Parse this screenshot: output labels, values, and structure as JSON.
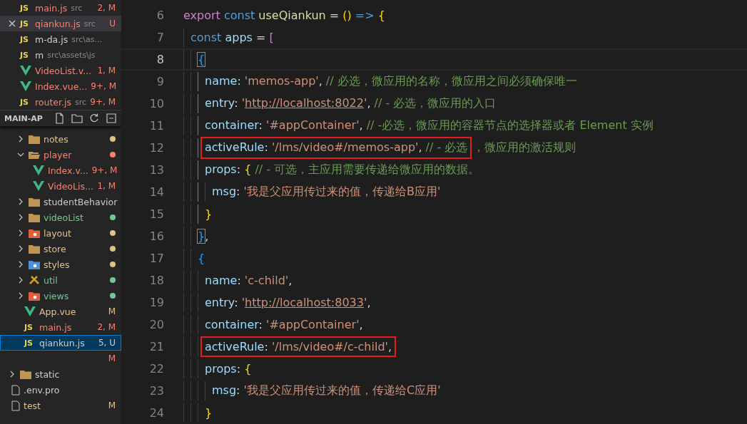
{
  "open_editors": [
    {
      "kind": "js",
      "icon": "JS",
      "name": "main.js",
      "desc": "src",
      "badge": "2, M",
      "color": "#f88070",
      "hovered": false
    },
    {
      "kind": "js",
      "icon": "JS",
      "name": "qiankun.js",
      "desc": "src",
      "badge": "U",
      "color": "#f88070",
      "hovered": true
    },
    {
      "kind": "js",
      "icon": "JS",
      "name": "m-da.js",
      "desc": "src\\as...",
      "color": "#cccccc",
      "hovered": false
    },
    {
      "kind": "js",
      "icon": "JS",
      "name": "m",
      "desc": "src\\assets\\js",
      "color": "#cccccc",
      "hovered": false
    },
    {
      "kind": "vue",
      "name": "VideoList.v...",
      "badge": "1, M",
      "color": "#f88070",
      "hovered": false
    },
    {
      "kind": "vue",
      "name": "Index.vue...",
      "badge": "9+, M",
      "color": "#f88070",
      "hovered": false
    },
    {
      "kind": "js",
      "icon": "JS",
      "name": "router.js",
      "desc": "src",
      "badge": "9+, M",
      "color": "#f88070",
      "hovered": false
    }
  ],
  "explorer": {
    "title": "MAIN-AP"
  },
  "tree": [
    {
      "kind": "group",
      "children": [
        {
          "kind": "folder",
          "name": "notes",
          "expanded": false,
          "color": "#e2c08d",
          "dot": true,
          "selected": false
        },
        {
          "kind": "folder",
          "name": "player",
          "expanded": true,
          "color": "#f88070",
          "dot": true,
          "selected": false,
          "children": [
            {
              "kind": "vue",
              "name": "Index.v...",
              "badge": "9+, M",
              "color": "#f88070",
              "selected": false
            },
            {
              "kind": "vue",
              "name": "VideoLis...",
              "badge": "1, M",
              "color": "#f88070",
              "selected": false
            }
          ]
        },
        {
          "kind": "folder",
          "name": "studentBehavior",
          "expanded": false,
          "color": "#cccccc",
          "dot": false,
          "selected": false
        },
        {
          "kind": "folder",
          "name": "videoList",
          "expanded": false,
          "color": "#73c991",
          "dot": true,
          "selected": false
        },
        {
          "kind": "folder_red",
          "name": "layout",
          "expanded": false,
          "color": "#e2c08d",
          "dot": true,
          "selected": false
        },
        {
          "kind": "folder",
          "name": "store",
          "expanded": false,
          "color": "#e2c08d",
          "dot": true,
          "selected": false
        },
        {
          "kind": "folder_blue",
          "name": "styles",
          "expanded": false,
          "color": "#e2c08d",
          "dot": true,
          "selected": false
        },
        {
          "kind": "folder_tools",
          "name": "util",
          "expanded": false,
          "color": "#73c991",
          "dot": true,
          "selected": false
        },
        {
          "kind": "folder_red",
          "name": "views",
          "expanded": false,
          "color": "#73c991",
          "dot": true,
          "selected": false
        },
        {
          "kind": "vue",
          "name": "App.vue",
          "badge": "M",
          "color": "#e2c08d",
          "selected": false
        },
        {
          "kind": "js",
          "icon": "JS",
          "name": "main.js",
          "badge": "2, M",
          "color": "#f88070",
          "selected": false
        },
        {
          "kind": "js",
          "icon": "JS",
          "name": "qiankun.js",
          "badge": "5, U",
          "color": "#cccccc",
          "selected": true
        },
        {
          "kind": "blank",
          "badge": "M",
          "color": "#f88070",
          "selected": false
        }
      ]
    },
    {
      "kind": "folder",
      "name": "static",
      "expanded": false,
      "color": "#cccccc",
      "dot": false,
      "selected": false
    },
    {
      "kind": "file",
      "name": ".env.pro",
      "color": "#cccccc",
      "selected": false
    },
    {
      "kind": "file",
      "name": "test",
      "badge": "M",
      "color": "#e2c08d",
      "selected": false
    }
  ],
  "editor": {
    "lines": [
      {
        "number": "6",
        "current": false,
        "tokens": [
          {
            "kind": "export",
            "text": "export"
          },
          {
            "kind": "keyword",
            "text": " const "
          },
          {
            "kind": "func",
            "text": "useQiankun"
          },
          {
            "kind": "punct",
            "text": " = "
          },
          {
            "kind": "bracket1",
            "text": "()"
          },
          {
            "kind": "keyword",
            "text": " => "
          },
          {
            "kind": "bracket1",
            "text": "{"
          }
        ]
      },
      {
        "number": "7",
        "current": false,
        "guides": [
          {
            "active": false
          }
        ],
        "tokens": [
          {
            "kind": "keyword",
            "text": "const "
          },
          {
            "kind": "var",
            "text": "apps"
          },
          {
            "kind": "punct",
            "text": " = "
          },
          {
            "kind": "bracket2",
            "text": "["
          }
        ]
      },
      {
        "number": "8",
        "current": true,
        "guides": [
          {
            "active": false
          },
          {
            "active": false
          }
        ],
        "tokens": [
          {
            "kind": "match",
            "text": "{"
          }
        ]
      },
      {
        "number": "9",
        "current": false,
        "guides": [
          {
            "active": false
          },
          {
            "active": false
          },
          {
            "active": true
          }
        ],
        "tokens": [
          {
            "kind": "prop",
            "text": "name"
          },
          {
            "kind": "punct",
            "text": ": "
          },
          {
            "kind": "string",
            "text": "'memos-app'"
          },
          {
            "kind": "punct",
            "text": ", "
          },
          {
            "kind": "comment",
            "text": "// 必选，微应用的名称，微应用之间必须确保唯一"
          }
        ]
      },
      {
        "number": "10",
        "current": false,
        "guides": [
          {
            "active": false
          },
          {
            "active": false
          },
          {
            "active": true
          }
        ],
        "tokens": [
          {
            "kind": "prop",
            "text": "entry"
          },
          {
            "kind": "punct",
            "text": ": "
          },
          {
            "kind": "string",
            "text": "'"
          },
          {
            "kind": "url",
            "text": "http://localhost:8022"
          },
          {
            "kind": "string",
            "text": "'"
          },
          {
            "kind": "punct",
            "text": ", "
          },
          {
            "kind": "comment",
            "text": "// - 必选，微应用的入口"
          }
        ]
      },
      {
        "number": "11",
        "current": false,
        "guides": [
          {
            "active": false
          },
          {
            "active": false
          },
          {
            "active": true
          }
        ],
        "tokens": [
          {
            "kind": "prop",
            "text": "container"
          },
          {
            "kind": "punct",
            "text": ": "
          },
          {
            "kind": "string",
            "text": "'#appContainer'"
          },
          {
            "kind": "punct",
            "text": ", "
          },
          {
            "kind": "comment",
            "text": "// -必选，微应用的容器节点的选择器或者 Element 实例"
          }
        ]
      },
      {
        "number": "12",
        "current": false,
        "guides": [
          {
            "active": false
          },
          {
            "active": false
          },
          {
            "active": true
          }
        ],
        "boxed_tokens": [
          {
            "kind": "prop",
            "text": "activeRule"
          },
          {
            "kind": "punct",
            "text": ": "
          },
          {
            "kind": "string",
            "text": "'/lms/video#/memos-app'"
          },
          {
            "kind": "punct",
            "text": ", "
          },
          {
            "kind": "comment",
            "text": "// - 必选"
          }
        ],
        "tokens": [
          {
            "kind": "comment",
            "text": "，微应用的激活规则"
          }
        ]
      },
      {
        "number": "13",
        "current": false,
        "guides": [
          {
            "active": false
          },
          {
            "active": false
          },
          {
            "active": true
          }
        ],
        "tokens": [
          {
            "kind": "prop",
            "text": "props"
          },
          {
            "kind": "punct",
            "text": ": "
          },
          {
            "kind": "bracket1",
            "text": "{"
          },
          {
            "kind": "comment",
            "text": " // - 可选，主应用需要传递给微应用的数据。"
          }
        ]
      },
      {
        "number": "14",
        "current": false,
        "guides": [
          {
            "active": false
          },
          {
            "active": false
          },
          {
            "active": true
          },
          {
            "active": false
          }
        ],
        "tokens": [
          {
            "kind": "prop",
            "text": "msg"
          },
          {
            "kind": "punct",
            "text": ": "
          },
          {
            "kind": "string",
            "text": "'我是父应用传过来的值，传递给B应用'"
          }
        ]
      },
      {
        "number": "15",
        "current": false,
        "guides": [
          {
            "active": false
          },
          {
            "active": false
          },
          {
            "active": true
          }
        ],
        "tokens": [
          {
            "kind": "bracket1",
            "text": "}"
          }
        ]
      },
      {
        "number": "16",
        "current": false,
        "guides": [
          {
            "active": false
          },
          {
            "active": false
          }
        ],
        "tokens": [
          {
            "kind": "match",
            "text": "}"
          },
          {
            "kind": "punct",
            "text": ","
          }
        ]
      },
      {
        "number": "17",
        "current": false,
        "guides": [
          {
            "active": false
          },
          {
            "active": false
          }
        ],
        "tokens": [
          {
            "kind": "bracket3",
            "text": "{"
          }
        ]
      },
      {
        "number": "18",
        "current": false,
        "guides": [
          {
            "active": false
          },
          {
            "active": false
          },
          {
            "active": false
          }
        ],
        "tokens": [
          {
            "kind": "prop",
            "text": "name"
          },
          {
            "kind": "punct",
            "text": ": "
          },
          {
            "kind": "string",
            "text": "'c-child'"
          },
          {
            "kind": "punct",
            "text": ","
          }
        ]
      },
      {
        "number": "19",
        "current": false,
        "guides": [
          {
            "active": false
          },
          {
            "active": false
          },
          {
            "active": false
          }
        ],
        "tokens": [
          {
            "kind": "prop",
            "text": "entry"
          },
          {
            "kind": "punct",
            "text": ": "
          },
          {
            "kind": "string",
            "text": "'"
          },
          {
            "kind": "url",
            "text": "http://localhost:8033"
          },
          {
            "kind": "string",
            "text": "'"
          },
          {
            "kind": "punct",
            "text": ","
          }
        ]
      },
      {
        "number": "20",
        "current": false,
        "guides": [
          {
            "active": false
          },
          {
            "active": false
          },
          {
            "active": false
          }
        ],
        "tokens": [
          {
            "kind": "prop",
            "text": "container"
          },
          {
            "kind": "punct",
            "text": ": "
          },
          {
            "kind": "string",
            "text": "'#appContainer'"
          },
          {
            "kind": "punct",
            "text": ","
          }
        ]
      },
      {
        "number": "21",
        "current": false,
        "guides": [
          {
            "active": false
          },
          {
            "active": false
          },
          {
            "active": false
          }
        ],
        "boxed_tokens": [
          {
            "kind": "prop",
            "text": "activeRule"
          },
          {
            "kind": "punct",
            "text": ": "
          },
          {
            "kind": "string",
            "text": "'/lms/video#/c-child'"
          },
          {
            "kind": "punct",
            "text": ","
          }
        ]
      },
      {
        "number": "22",
        "current": false,
        "guides": [
          {
            "active": false
          },
          {
            "active": false
          },
          {
            "active": false
          }
        ],
        "tokens": [
          {
            "kind": "prop",
            "text": "props"
          },
          {
            "kind": "punct",
            "text": ": "
          },
          {
            "kind": "bracket1",
            "text": "{"
          }
        ]
      },
      {
        "number": "23",
        "current": false,
        "guides": [
          {
            "active": false
          },
          {
            "active": false
          },
          {
            "active": false
          },
          {
            "active": false
          }
        ],
        "tokens": [
          {
            "kind": "prop",
            "text": "msg"
          },
          {
            "kind": "punct",
            "text": ": "
          },
          {
            "kind": "string",
            "text": "'我是父应用传过来的值，传递给C应用'"
          }
        ]
      },
      {
        "number": "24",
        "current": false,
        "guides": [
          {
            "active": false
          },
          {
            "active": false
          },
          {
            "active": false
          }
        ],
        "tokens": [
          {
            "kind": "bracket1",
            "text": "}"
          }
        ]
      }
    ]
  }
}
